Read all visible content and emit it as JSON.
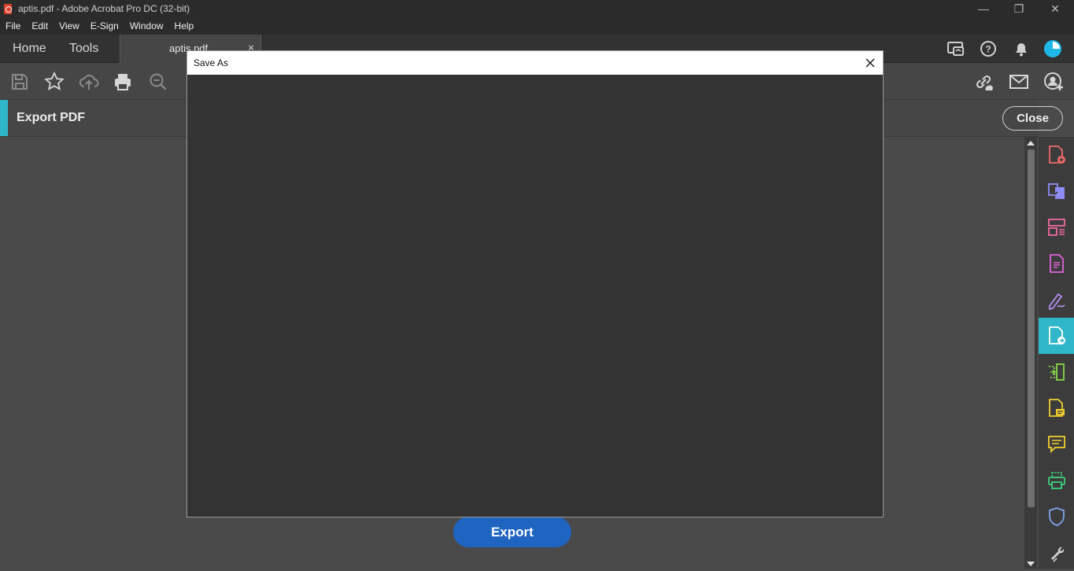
{
  "window": {
    "title": "aptis.pdf - Adobe Acrobat Pro DC (32-bit)",
    "minimize_glyph": "—",
    "restore_glyph": "❐",
    "close_glyph": "✕"
  },
  "menu": [
    "File",
    "Edit",
    "View",
    "E-Sign",
    "Window",
    "Help"
  ],
  "tabs": {
    "home": "Home",
    "tools": "Tools",
    "document": "aptis.pdf",
    "document_close": "×"
  },
  "header_icons": [
    "share-screen-icon",
    "help-icon",
    "bell-icon",
    "avatar"
  ],
  "toolbar_icons": [
    "save-icon",
    "star-icon",
    "upload-cloud-icon",
    "print-icon",
    "zoom-icon",
    "link-icon",
    "mail-icon",
    "add-user-icon"
  ],
  "export_panel": {
    "title": "Export PDF",
    "close_label": "Close",
    "export_label": "Export"
  },
  "dialog": {
    "title": "Save As",
    "close_glyph": "✕"
  },
  "rail": {
    "icons": [
      "create-pdf-icon",
      "combine-files-icon",
      "organize-pages-icon",
      "edit-pdf-icon",
      "fill-sign-icon",
      "export-pdf-icon",
      "scan-ocr-icon",
      "comment-file-icon",
      "comment-icon",
      "print-production-icon",
      "protect-icon",
      "tools-wrench-icon"
    ],
    "active": "export-pdf-icon"
  },
  "colors": {
    "accent": "#2fb6c8",
    "export_button": "#1f64c0",
    "pdf_red": "#d9412c"
  }
}
